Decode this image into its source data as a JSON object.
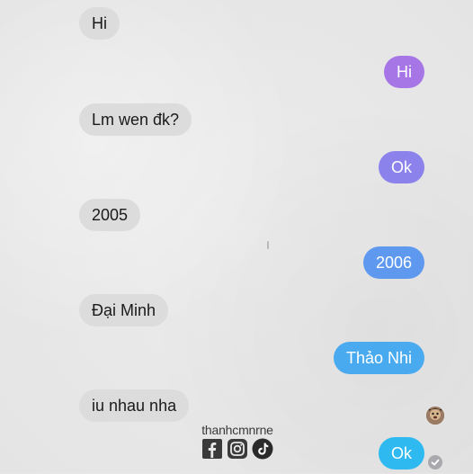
{
  "conversation": {
    "messages": [
      {
        "side": "incoming",
        "text": "Hi"
      },
      {
        "side": "outgoing",
        "text": "Hi",
        "color": "#a676e6"
      },
      {
        "side": "incoming",
        "text": "Lm wen đk?"
      },
      {
        "side": "outgoing",
        "text": "Ok",
        "color": "#8b82ec"
      },
      {
        "side": "incoming",
        "text": "2005"
      },
      {
        "side": "outgoing",
        "text": "2006",
        "color": "#5f99ef"
      },
      {
        "side": "incoming",
        "text": "Đại Minh"
      },
      {
        "side": "outgoing",
        "text": "Thảo Nhi",
        "color": "#4aaaf0"
      },
      {
        "side": "incoming",
        "text": "iu nhau nha"
      },
      {
        "side": "outgoing",
        "text": "Ok",
        "color": "#2ebaf1"
      }
    ]
  },
  "watermark": {
    "handle": "thanhcmnrne",
    "icons": [
      "facebook-icon",
      "instagram-icon",
      "tiktok-icon"
    ]
  },
  "status": {
    "avatar_icon": "avatar-icon",
    "read_icon": "check-circle-icon"
  }
}
